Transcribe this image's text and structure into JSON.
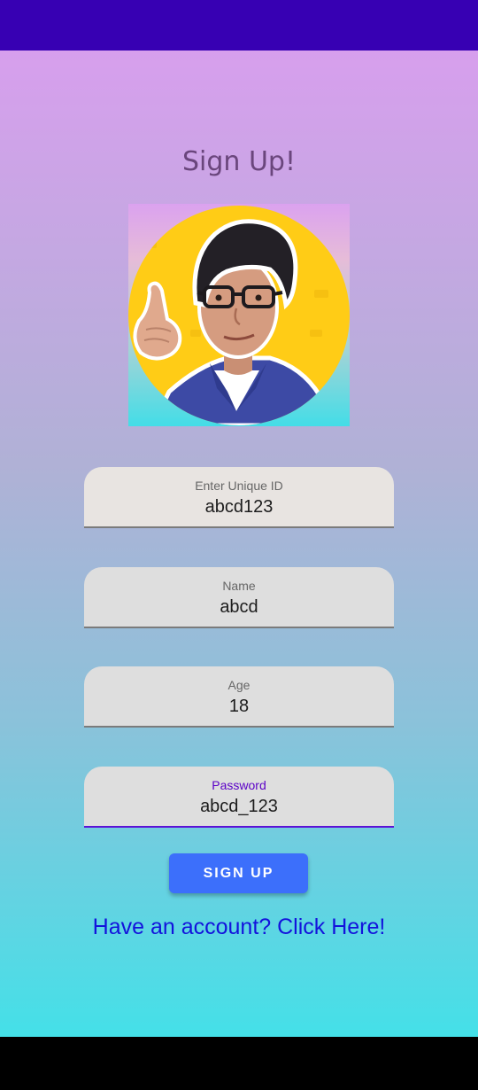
{
  "page": {
    "title": "Sign Up!"
  },
  "avatar": {
    "description": "profile-photo"
  },
  "form": {
    "unique_id": {
      "label": "Enter Unique ID",
      "value": "abcd123"
    },
    "name": {
      "label": "Name",
      "value": "abcd"
    },
    "age": {
      "label": "Age",
      "value": "18"
    },
    "password": {
      "label": "Password",
      "value": "abcd_123"
    }
  },
  "actions": {
    "signup_label": "SIGN UP",
    "login_link": "Have an account? Click Here!"
  },
  "colors": {
    "status_bar": "#3700b3",
    "button": "#3c6ffb",
    "link": "#1313dc",
    "focus_accent": "#5b12d6"
  }
}
